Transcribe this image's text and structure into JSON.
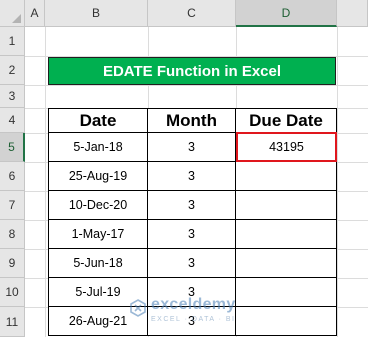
{
  "columns": [
    "A",
    "B",
    "C",
    "D"
  ],
  "selected_column": "D",
  "rows": [
    "1",
    "2",
    "3",
    "4",
    "5",
    "6",
    "7",
    "8",
    "9",
    "10",
    "11"
  ],
  "selected_row": "5",
  "banner": {
    "title": "EDATE Function in Excel",
    "color": "#00b050"
  },
  "table": {
    "headers": [
      "Date",
      "Month",
      "Due Date"
    ],
    "rows": [
      [
        "5-Jan-18",
        "3",
        "43195"
      ],
      [
        "25-Aug-19",
        "3",
        ""
      ],
      [
        "10-Dec-20",
        "3",
        ""
      ],
      [
        "1-May-17",
        "3",
        ""
      ],
      [
        "5-Jun-18",
        "3",
        ""
      ],
      [
        "5-Jul-19",
        "3",
        ""
      ],
      [
        "26-Aug-21",
        "3",
        ""
      ]
    ]
  },
  "active_cell": {
    "ref": "D5",
    "value": "43195",
    "outline_color": "#e0161d"
  },
  "watermark": {
    "name": "exceldemy",
    "tagline": "EXCEL · DATA · BI",
    "icon": "exceldemy-logo-icon"
  }
}
